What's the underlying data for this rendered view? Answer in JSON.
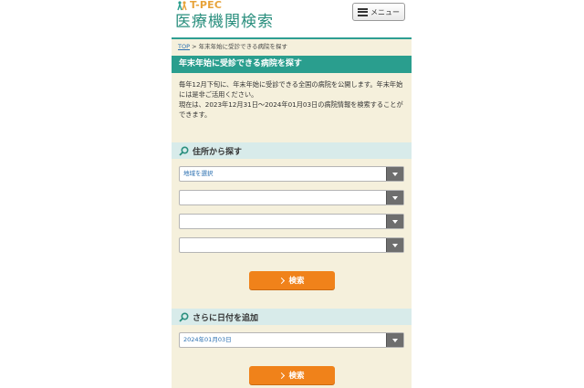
{
  "header": {
    "logo_sub": "T-PEC",
    "logo_main": "医療機関検索",
    "menu_label": "メニュー"
  },
  "breadcrumb": {
    "home": "TOP",
    "separator": ">",
    "current": "年末年始に受診できる病院を探す"
  },
  "page_title": "年末年始に受診できる病院を探す",
  "intro": {
    "line1": "毎年12月下旬に、年末年始に受診できる全国の病院を公開します。年末年始には是非ご活用ください。",
    "line2": "現在は、2023年12月31日～2024年01月03日の病院情報を検索することができます。"
  },
  "address_section": {
    "title": "住所から探す",
    "selects": [
      {
        "value": "地域を選択"
      },
      {
        "value": ""
      },
      {
        "value": ""
      },
      {
        "value": ""
      }
    ],
    "search_label": "検索"
  },
  "date_section": {
    "title": "さらに日付を追加",
    "date_value": "2024年01月03日",
    "search_label": "検索"
  },
  "colors": {
    "accent_teal": "#2a9e8e",
    "button_orange": "#f0821a",
    "page_bg": "#f5f0dc",
    "section_bg": "#d8ebea"
  },
  "icons": {
    "logo": "people-logo-icon",
    "menu": "list-menu-icon",
    "section": "search-magnifier-icon",
    "select": "triangle-down-icon",
    "button": "chevron-right-icon"
  }
}
